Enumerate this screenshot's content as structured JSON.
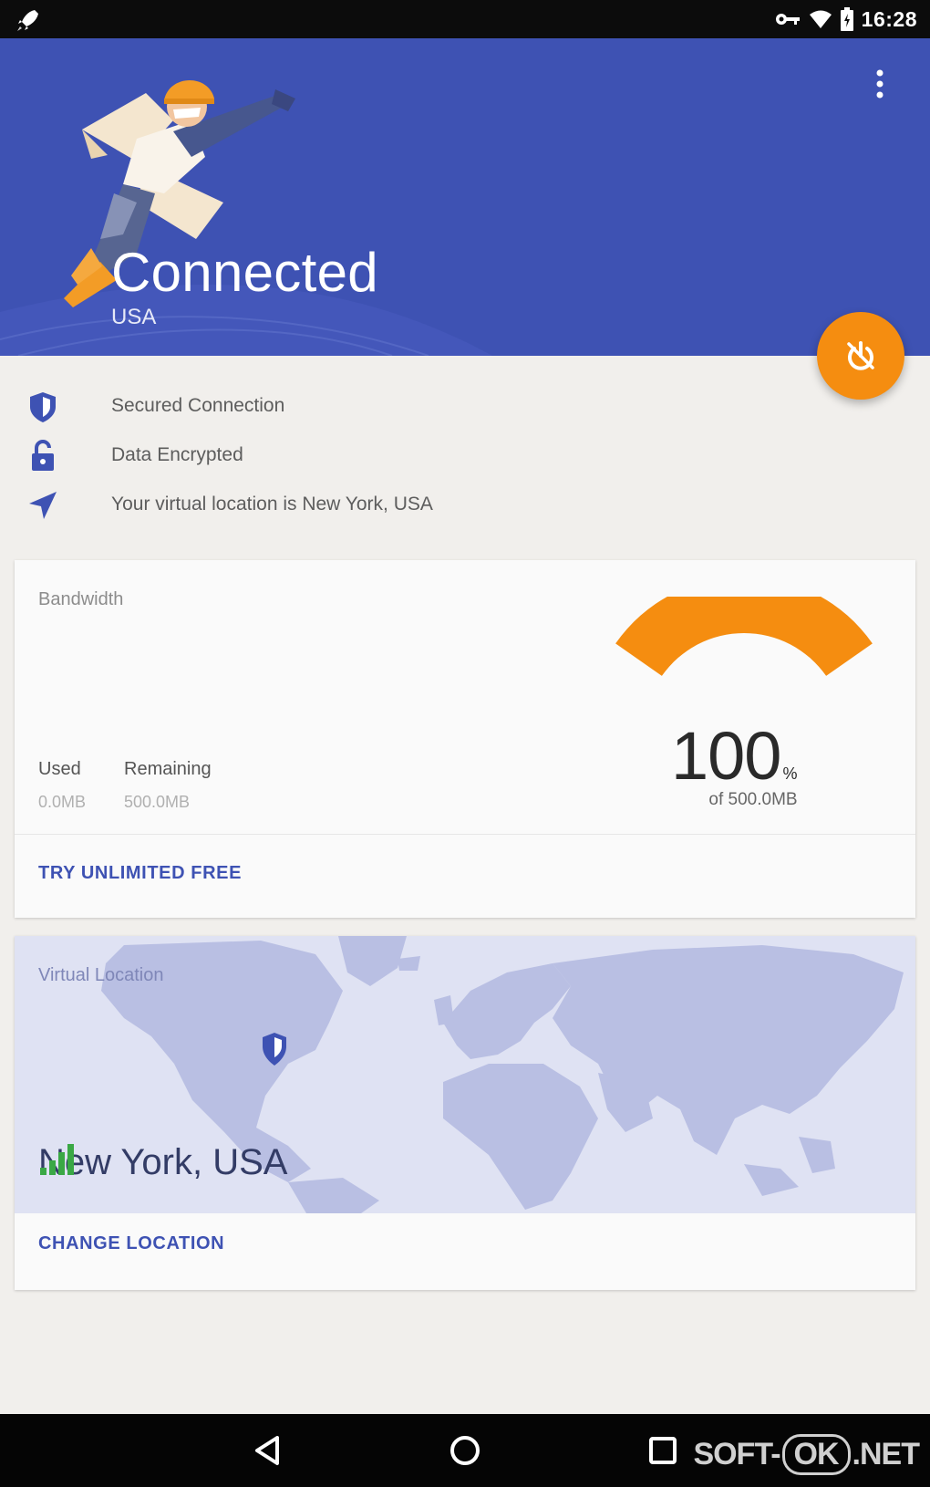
{
  "status_bar": {
    "time": "16:28",
    "icons": [
      "rocket-icon",
      "vpn-key-icon",
      "wifi-icon",
      "battery-icon"
    ]
  },
  "header": {
    "title": "Connected",
    "subtitle": "USA",
    "background_color": "#3e52b3",
    "menu_icon": "more-vert-icon"
  },
  "fab": {
    "icon": "power-off-icon",
    "color": "#f58d10"
  },
  "status_items": [
    {
      "icon": "shield-icon",
      "label": "Secured Connection"
    },
    {
      "icon": "lock-icon",
      "label": "Data Encrypted"
    },
    {
      "icon": "navigation-icon",
      "label": "Your virtual location is New York, USA"
    }
  ],
  "bandwidth": {
    "label": "Bandwidth",
    "used_label": "Used",
    "used_value": "0.0MB",
    "remaining_label": "Remaining",
    "remaining_value": "500.0MB",
    "gauge_value": "100",
    "gauge_unit": "%",
    "gauge_fraction": 1.0,
    "gauge_caption": "of 500.0MB",
    "gauge_color": "#f58d10",
    "action": "TRY UNLIMITED FREE"
  },
  "location": {
    "label": "Virtual Location",
    "city": "New York, USA",
    "action": "CHANGE LOCATION",
    "signal_color": "#3aa845"
  },
  "nav_bar": {
    "buttons": [
      "back-icon",
      "home-icon",
      "recents-icon"
    ]
  },
  "watermark": {
    "left": "SOFT-",
    "middle": "OK",
    "right": ".NET"
  }
}
